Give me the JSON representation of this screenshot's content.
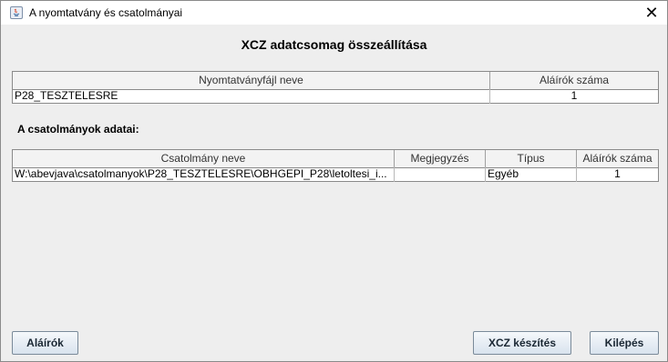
{
  "window": {
    "title": "A nyomtatvány és csatolmányai",
    "close_label": "✕"
  },
  "heading": "XCZ adatcsomag összeállítása",
  "form_table": {
    "columns": [
      "Nyomtatványfájl neve",
      "Aláírók száma"
    ],
    "rows": [
      [
        "P28_TESZTELESRE",
        "1"
      ]
    ]
  },
  "attachments_label": "A csatolmányok adatai:",
  "attachments_table": {
    "columns": [
      "Csatolmány neve",
      "Megjegyzés",
      "Típus",
      "Aláírók száma"
    ],
    "rows": [
      [
        "W:\\abevjava\\csatolmanyok\\P28_TESZTELESRE\\OBHGEPI_P28\\letoltesi_i...",
        "",
        "Egyéb",
        "1"
      ]
    ]
  },
  "buttons": {
    "signers": "Aláírók",
    "create_xcz": "XCZ készítés",
    "exit": "Kilépés"
  }
}
